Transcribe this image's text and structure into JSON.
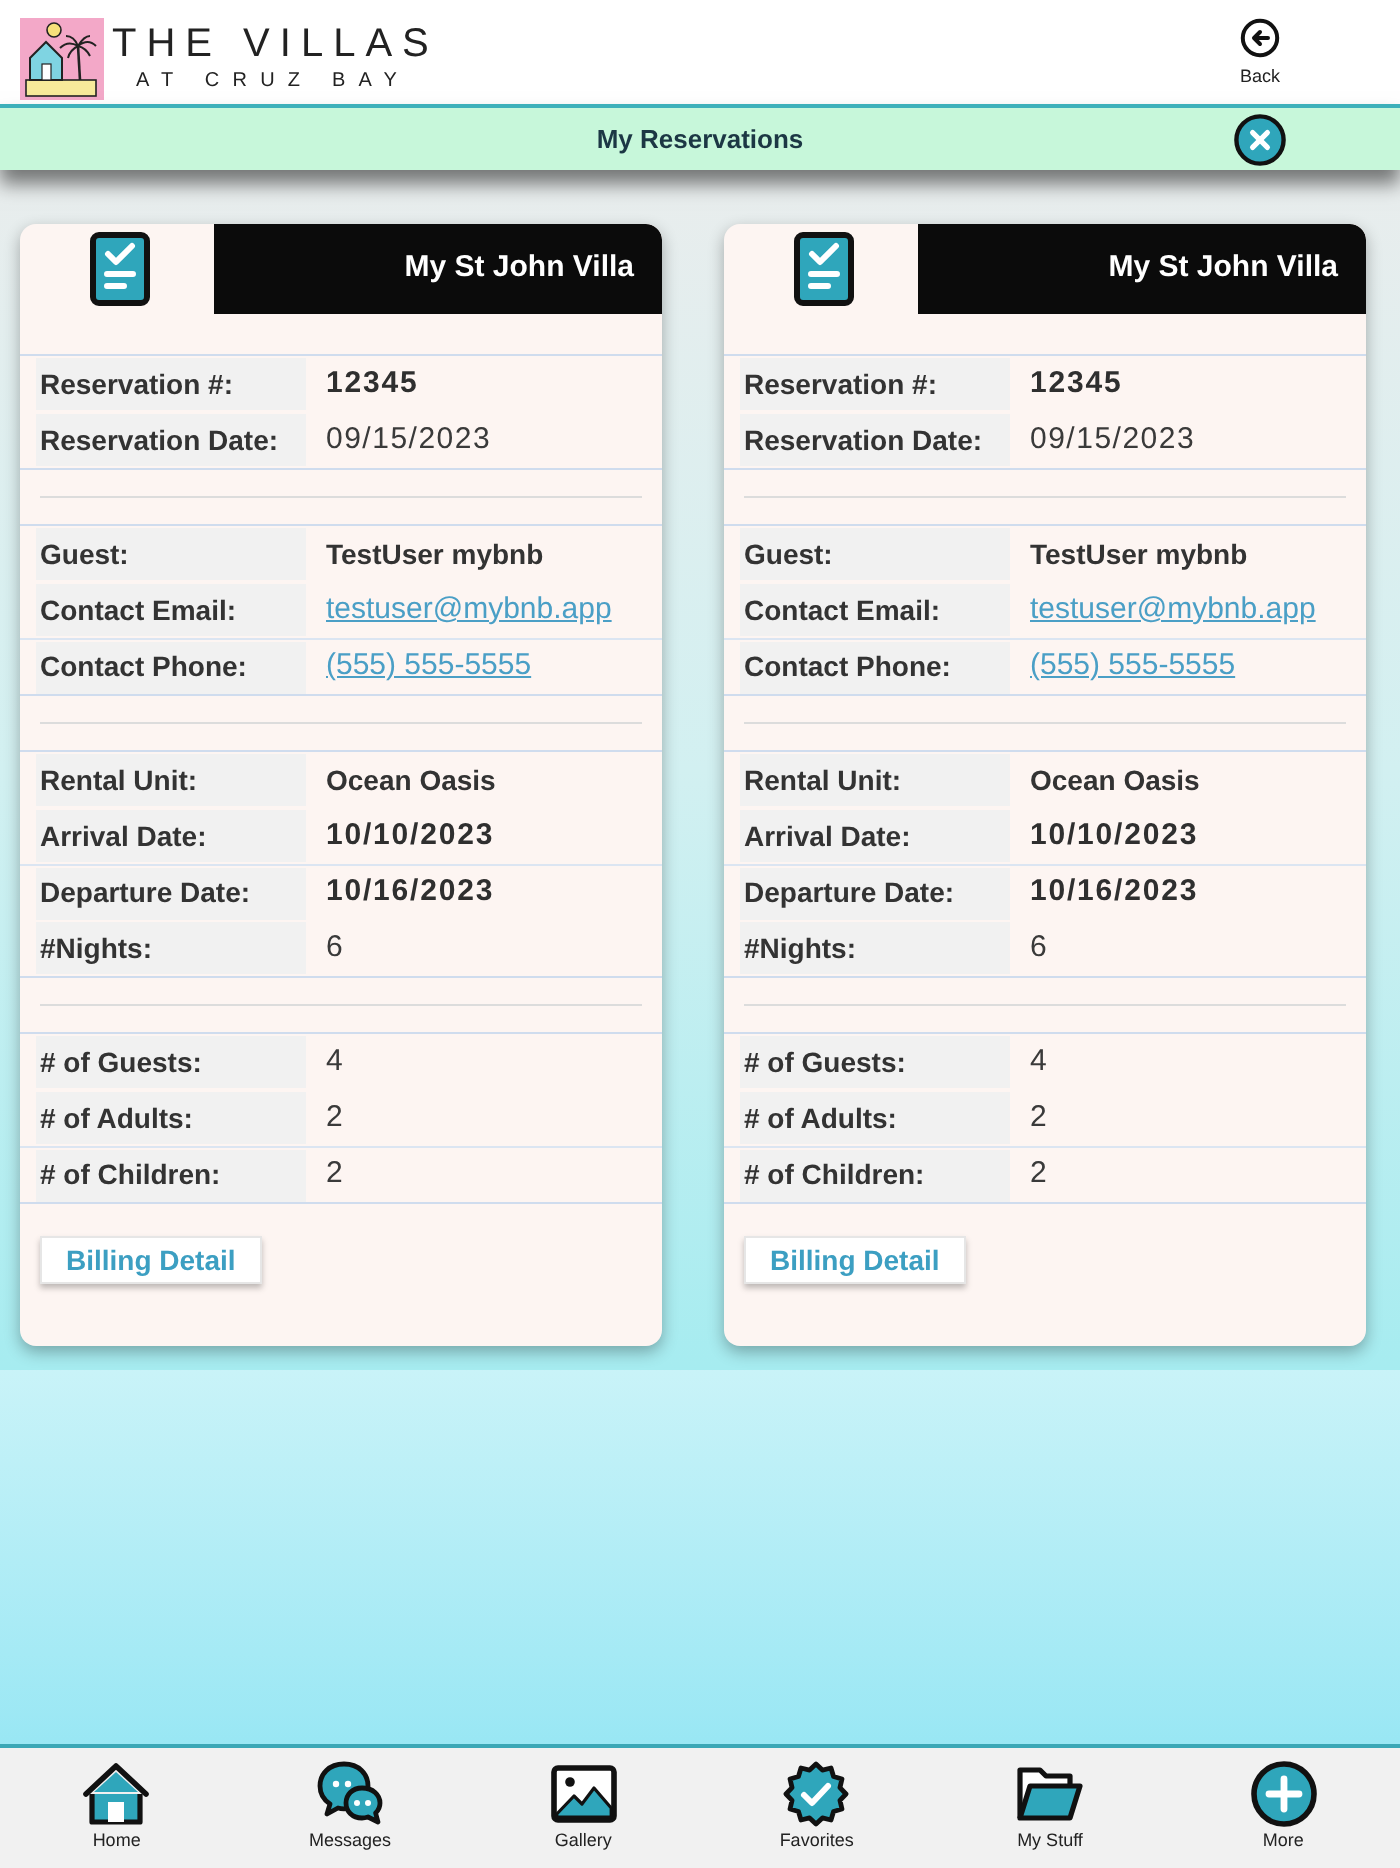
{
  "header": {
    "logo": {
      "title": "THE VILLAS",
      "subtitle": "AT CRUZ BAY"
    },
    "back_button": {
      "label": "Back"
    }
  },
  "title_bar": {
    "title": "My Reservations"
  },
  "reservations": [
    {
      "title": "My St John Villa",
      "sections": [
        {
          "fields": [
            {
              "label": "Reservation #:",
              "value": "12345",
              "kind": "figure"
            },
            {
              "label": "Reservation Date:",
              "value": "09/15/2023",
              "kind": "plain"
            }
          ]
        },
        {
          "fields": [
            {
              "label": "Guest:",
              "value": "TestUser mybnb",
              "kind": "strong"
            },
            {
              "label": "Contact Email:",
              "value": "testuser@mybnb.app",
              "kind": "link"
            },
            {
              "label": "Contact Phone:",
              "value": "(555) 555-5555",
              "kind": "link"
            }
          ]
        },
        {
          "fields": [
            {
              "label": "Rental Unit:",
              "value": "Ocean Oasis",
              "kind": "strong"
            },
            {
              "label": "Arrival Date:",
              "value": "10/10/2023",
              "kind": "figure"
            },
            {
              "label": "Departure Date:",
              "value": "10/16/2023",
              "kind": "figure"
            },
            {
              "label": "#Nights:",
              "value": "6",
              "kind": "plain"
            }
          ]
        },
        {
          "fields": [
            {
              "label": "# of Guests:",
              "value": "4",
              "kind": "plain"
            },
            {
              "label": "# of Adults:",
              "value": "2",
              "kind": "plain"
            },
            {
              "label": "# of Children:",
              "value": "2",
              "kind": "plain"
            }
          ]
        }
      ],
      "button": "Billing Detail"
    },
    {
      "title": "My St John Villa",
      "sections": [
        {
          "fields": [
            {
              "label": "Reservation #:",
              "value": "12345",
              "kind": "figure"
            },
            {
              "label": "Reservation Date:",
              "value": "09/15/2023",
              "kind": "plain"
            }
          ]
        },
        {
          "fields": [
            {
              "label": "Guest:",
              "value": "TestUser mybnb",
              "kind": "strong"
            },
            {
              "label": "Contact Email:",
              "value": "testuser@mybnb.app",
              "kind": "link"
            },
            {
              "label": "Contact Phone:",
              "value": "(555) 555-5555",
              "kind": "link"
            }
          ]
        },
        {
          "fields": [
            {
              "label": "Rental Unit:",
              "value": "Ocean Oasis",
              "kind": "strong"
            },
            {
              "label": "Arrival Date:",
              "value": "10/10/2023",
              "kind": "figure"
            },
            {
              "label": "Departure Date:",
              "value": "10/16/2023",
              "kind": "figure"
            },
            {
              "label": "#Nights:",
              "value": "6",
              "kind": "plain"
            }
          ]
        },
        {
          "fields": [
            {
              "label": "# of Guests:",
              "value": "4",
              "kind": "plain"
            },
            {
              "label": "# of Adults:",
              "value": "2",
              "kind": "plain"
            },
            {
              "label": "# of Children:",
              "value": "2",
              "kind": "plain"
            }
          ]
        }
      ],
      "button": "Billing Detail"
    }
  ],
  "bottom_nav": [
    {
      "label": "Home"
    },
    {
      "label": "Messages"
    },
    {
      "label": "Gallery"
    },
    {
      "label": "Favorites"
    },
    {
      "label": "My Stuff"
    },
    {
      "label": "More"
    }
  ]
}
